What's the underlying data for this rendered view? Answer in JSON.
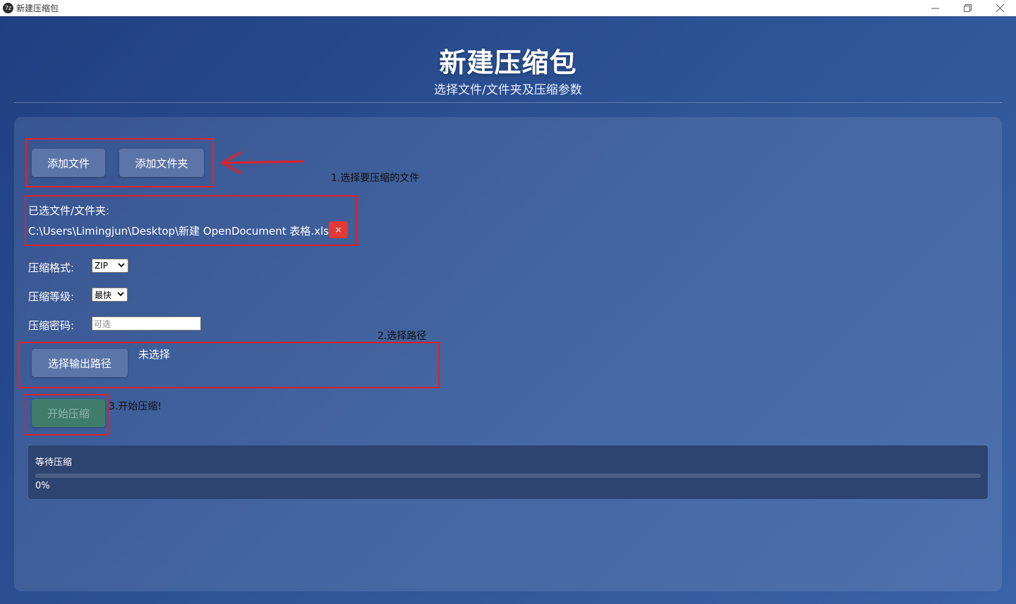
{
  "window": {
    "title": "新建压缩包",
    "app_icon": "app-logo-icon",
    "controls": {
      "minimize": "minimize-icon",
      "restore": "restore-icon",
      "close": "close-icon"
    }
  },
  "header": {
    "title": "新建压缩包",
    "subtitle": "选择文件/文件夹及压缩参数"
  },
  "actions": {
    "add_file": "添加文件",
    "add_folder": "添加文件夹",
    "choose_output": "选择输出路径",
    "start": "开始压缩"
  },
  "selection": {
    "label": "已选文件/文件夹:",
    "files": [
      "C:\\Users\\Limingjun\\Desktop\\新建 OpenDocument 表格.xlsx"
    ],
    "remove_symbol": "×"
  },
  "options": {
    "format_label": "压缩格式:",
    "format_value": "ZIP",
    "level_label": "压缩等级:",
    "level_value": "最快",
    "password_label": "压缩密码:",
    "password_placeholder": "可选"
  },
  "output": {
    "path_value": "未选择"
  },
  "annotations": {
    "step1": "1.选择要压缩的文件",
    "step2": "2.选择路径",
    "step3": "3.开始压缩!"
  },
  "progress": {
    "status": "等待压缩",
    "percent_text": "0%",
    "value": 0
  },
  "colors": {
    "accent_button": "#5b75a8",
    "start_button": "#3f7d6a",
    "remove_button": "#e53935",
    "annotation_red": "#e0202a"
  }
}
